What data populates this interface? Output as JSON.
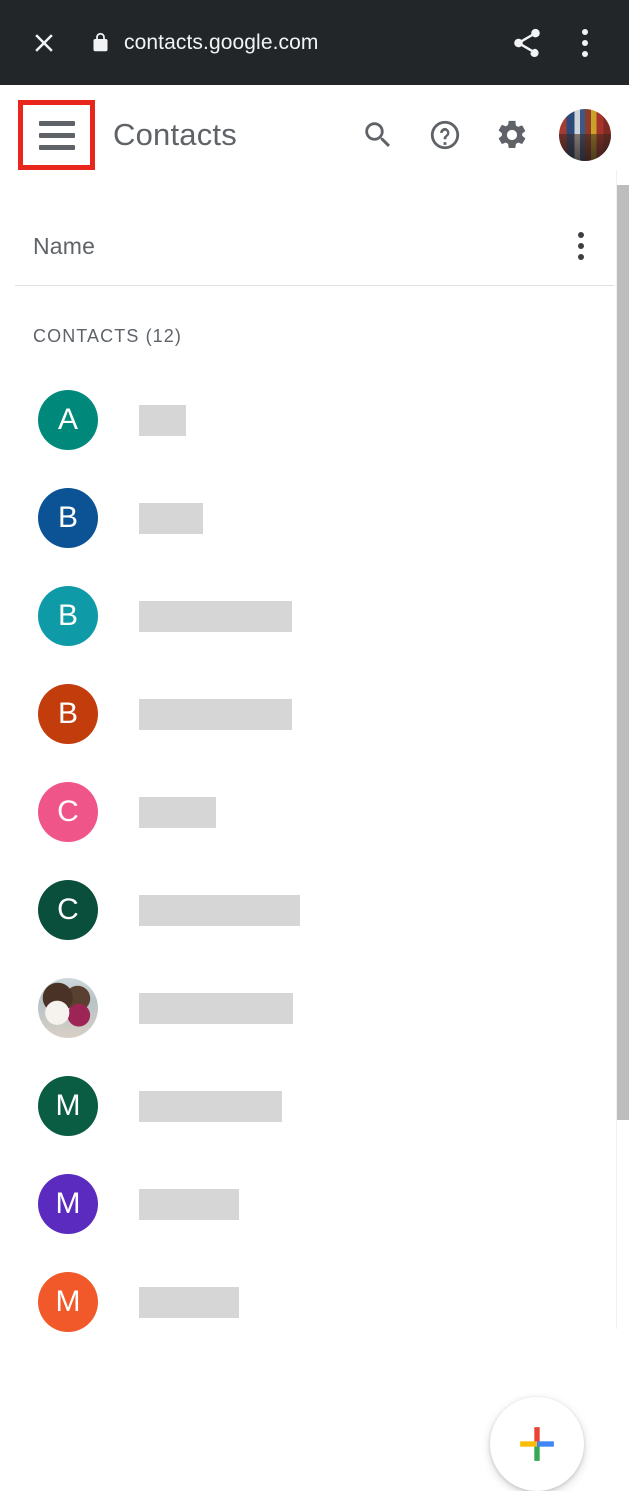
{
  "browser": {
    "close_icon": "close-icon",
    "lock_icon": "lock-icon",
    "url": "contacts.google.com",
    "share_icon": "share-icon",
    "overflow_icon": "more-vert-icon"
  },
  "app_header": {
    "menu_icon": "hamburger-menu-icon",
    "menu_highlight_color": "#e8261c",
    "title": "Contacts",
    "search_icon": "search-icon",
    "help_icon": "help-circle-icon",
    "settings_icon": "gear-icon",
    "account_avatar": "account-avatar"
  },
  "list_header": {
    "name_label": "Name",
    "overflow_icon": "more-vert-icon"
  },
  "section": {
    "label": "CONTACTS (12)"
  },
  "contacts": [
    {
      "initial": "A",
      "color": "#00897b",
      "name_width": 47,
      "avatar_type": "initial"
    },
    {
      "initial": "B",
      "color": "#0b5394",
      "name_width": 64,
      "avatar_type": "initial"
    },
    {
      "initial": "B",
      "color": "#0f9aa8",
      "name_width": 153,
      "avatar_type": "initial"
    },
    {
      "initial": "B",
      "color": "#c33c0c",
      "name_width": 153,
      "avatar_type": "initial"
    },
    {
      "initial": "C",
      "color": "#f0558a",
      "name_width": 77,
      "avatar_type": "initial"
    },
    {
      "initial": "C",
      "color": "#0a4e3c",
      "name_width": 161,
      "avatar_type": "initial"
    },
    {
      "initial": "",
      "color": "#cfd8dc",
      "name_width": 154,
      "avatar_type": "photo"
    },
    {
      "initial": "M",
      "color": "#0a5c42",
      "name_width": 143,
      "avatar_type": "initial"
    },
    {
      "initial": "M",
      "color": "#5b2bbf",
      "name_width": 100,
      "avatar_type": "initial"
    },
    {
      "initial": "M",
      "color": "#f1592a",
      "name_width": 100,
      "avatar_type": "initial"
    }
  ],
  "fab": {
    "icon": "google-plus-add-icon",
    "colors": {
      "red": "#ea4335",
      "blue": "#4285f4",
      "green": "#34a853",
      "yellow": "#fbbc05"
    }
  },
  "scrollbar": {
    "thumb_color": "#bdbdbd"
  }
}
